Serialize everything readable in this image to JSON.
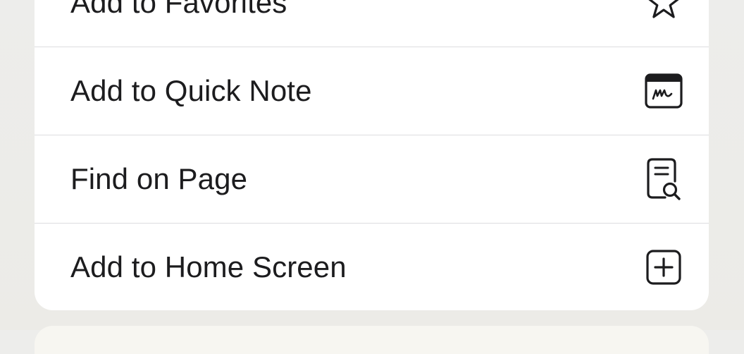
{
  "menu": {
    "items": [
      {
        "label": "Add to Favorites",
        "icon": "star-icon"
      },
      {
        "label": "Add to Quick Note",
        "icon": "quick-note-icon"
      },
      {
        "label": "Find on Page",
        "icon": "find-on-page-icon"
      },
      {
        "label": "Add to Home Screen",
        "icon": "add-square-icon"
      }
    ]
  },
  "colors": {
    "text": "#1c1c1e",
    "divider": "#dcdcdf",
    "panel": "#ffffff",
    "background": "#ecebe7"
  }
}
